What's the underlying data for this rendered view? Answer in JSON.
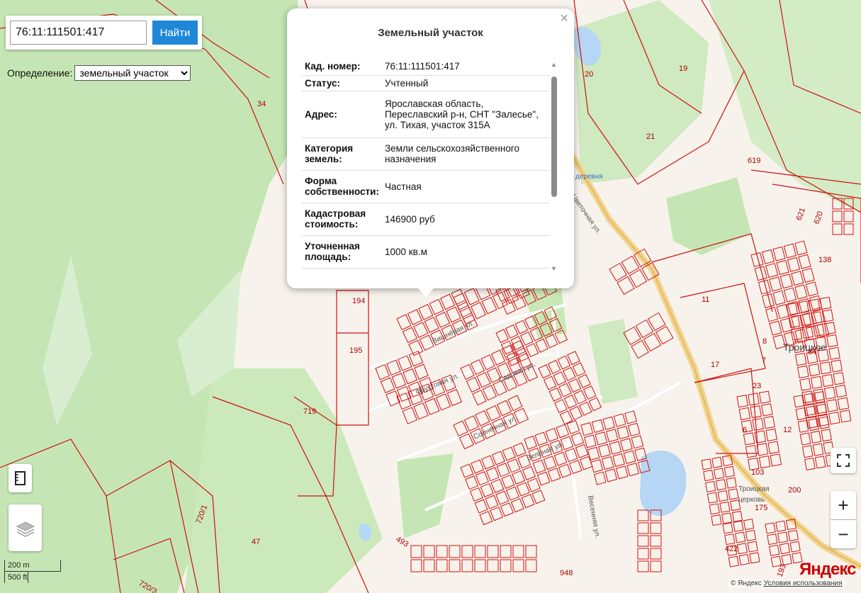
{
  "search": {
    "value": "76:11:111501:417",
    "button_label": "Найти"
  },
  "definition": {
    "label": "Определение:",
    "selected": "земельный участок"
  },
  "popup": {
    "close_glyph": "×",
    "title": "Земельный участок",
    "rows": [
      {
        "key": "Кад. номер:",
        "value": "76:11:111501:417"
      },
      {
        "key": "Статус:",
        "value": "Учтенный"
      },
      {
        "key": "Адрес:",
        "value": "Ярославская область, Переславский р-н, СНТ \"Залесье\", ул. Тихая, участок 315А"
      },
      {
        "key": "Категория земель:",
        "value": "Земли сельскохозяйственного назначения"
      },
      {
        "key": "Форма собственности:",
        "value": "Частная"
      },
      {
        "key": "Кадастровая стоимость:",
        "value": "146900 руб"
      },
      {
        "key": "Уточненная площадь:",
        "value": "1000 кв.м"
      }
    ]
  },
  "map_labels": {
    "parcels": [
      "34",
      "20",
      "19",
      "21",
      "619",
      "621",
      "620",
      "138",
      "11",
      "17",
      "8",
      "84",
      "7",
      "23",
      "6",
      "12",
      "103",
      "200",
      "175",
      "422",
      "193",
      "194",
      "195",
      "719",
      "720/1",
      "47",
      "720/3",
      "493",
      "948"
    ],
    "streets": [
      "Вишнёвая ул.",
      "Фруктовая ул.",
      "Садовая ул.",
      "Солнечная ул.",
      "Зелёная ул.",
      "Цветочная ул.",
      "Сиреневая ул.",
      "Вишнёвая ул.",
      "Луговая ул.",
      "Весенняя ул."
    ],
    "places": [
      "Троицкое",
      "деревня",
      "Троицкая церковь"
    ]
  },
  "controls": {
    "fullscreen_icon": "fullscreen-icon",
    "zoom_in": "+",
    "zoom_out": "−",
    "ruler_icon": "ruler-icon",
    "layers_icon": "layers-icon"
  },
  "scale": {
    "metric": "200 m",
    "imperial": "500 ft"
  },
  "logo": "Яндекс",
  "attribution": {
    "copyright": "© Яндекс",
    "terms": "Условия использования"
  },
  "colors": {
    "accent": "#1e87d8",
    "parcel_border": "#d01010",
    "forest": "#c5e6b4",
    "water": "#b5d6f5",
    "road": "#f4d48a"
  }
}
